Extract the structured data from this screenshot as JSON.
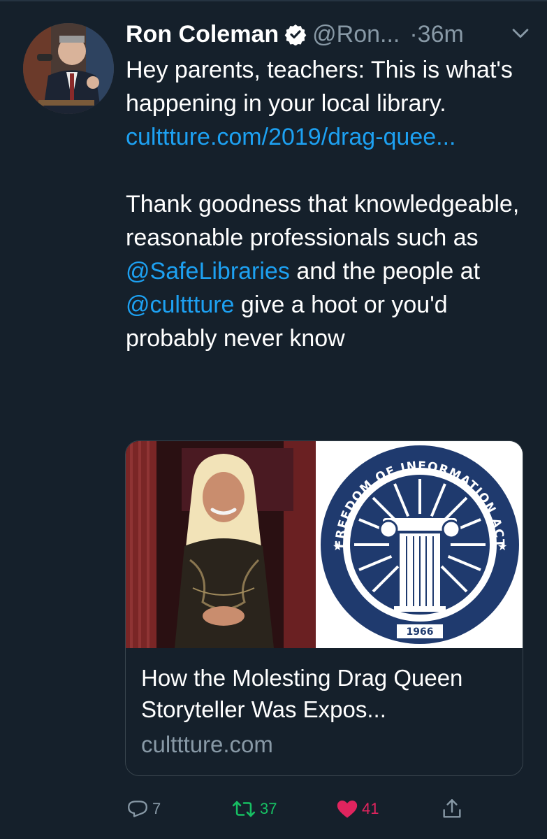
{
  "tweet": {
    "display_name": "Ron Coleman",
    "handle": "@Ron...",
    "timestamp": "·36m",
    "text": {
      "line1": "Hey parents, teachers: This is what's happening in your local library.",
      "link": "culttture.com/2019/drag-quee...",
      "p2_start": "Thank goodness that knowledgeable, reasonable professionals such as",
      "mention1": "@SafeLibraries",
      "p2_mid": "and the people at",
      "mention2": "@culttture",
      "p2_end": "give a hoot or you'd probably never know"
    },
    "card": {
      "title": "How the Molesting Drag Queen Storyteller Was Expos...",
      "domain": "culttture.com",
      "seal": {
        "top_text": "FREEDOM OF INFORMATION ACT",
        "year": "1966"
      }
    },
    "actions": {
      "reply_count": "7",
      "retweet_count": "37",
      "like_count": "41"
    }
  },
  "colors": {
    "background": "#15202b",
    "link": "#1da1f2",
    "secondary": "#8899a6",
    "retweet": "#17bf63",
    "like": "#e0245e",
    "seal_blue": "#1f3a6e"
  },
  "icons": [
    "verified-badge-icon",
    "chevron-down-icon",
    "reply-icon",
    "retweet-icon",
    "like-icon",
    "share-icon"
  ]
}
